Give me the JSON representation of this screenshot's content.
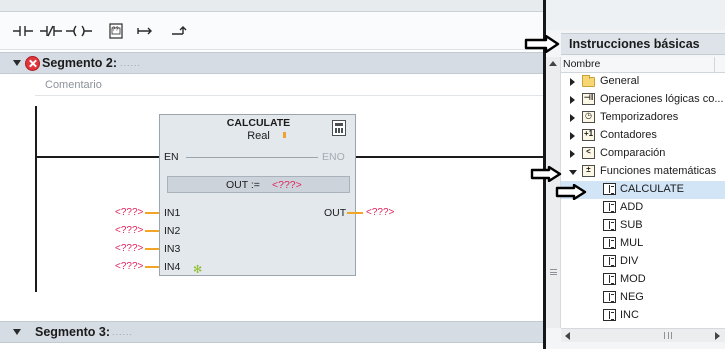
{
  "toolbar": {
    "items": [
      "no-contact-icon",
      "nc-contact-icon",
      "coil-icon",
      "empty-box-icon",
      "open-branch-icon",
      "close-branch-icon"
    ],
    "empty_box_label": "??"
  },
  "segments": [
    {
      "title": "Segmento 2:",
      "dots": "......",
      "has_error": true,
      "comment_placeholder": "Comentario"
    },
    {
      "title": "Segmento 3:",
      "dots": "......",
      "has_error": false
    }
  ],
  "block": {
    "name": "CALCULATE",
    "data_type": "Real",
    "en": "EN",
    "eno": "ENO",
    "expression": "OUT :=",
    "expression_value": "<???>",
    "output": "OUT",
    "output_value": "<???>",
    "inputs": [
      {
        "pin": "IN1",
        "value": "<???>"
      },
      {
        "pin": "IN2",
        "value": "<???>"
      },
      {
        "pin": "IN3",
        "value": "<???>"
      },
      {
        "pin": "IN4",
        "value": "<???>"
      }
    ]
  },
  "panel": {
    "title": "Instrucciones básicas",
    "column_header": "Nombre",
    "tree": [
      {
        "label": "General",
        "icon": "folder-icon",
        "level": 0,
        "expanded": false
      },
      {
        "label": "Operaciones lógicas co...",
        "icon": "bit-logic-icon",
        "icon_text": "⊣I",
        "level": 0,
        "expanded": false
      },
      {
        "label": "Temporizadores",
        "icon": "timer-icon",
        "icon_text": "◷",
        "level": 0,
        "expanded": false
      },
      {
        "label": "Contadores",
        "icon": "counter-icon",
        "icon_text": "+1",
        "level": 0,
        "expanded": false
      },
      {
        "label": "Comparación",
        "icon": "comparator-icon",
        "icon_text": "<",
        "level": 0,
        "expanded": false
      },
      {
        "label": "Funciones matemáticas",
        "icon": "math-functions-icon",
        "icon_text": "±",
        "level": 0,
        "expanded": true
      },
      {
        "label": "CALCULATE",
        "icon": "instruction-icon",
        "level": 1,
        "selected": true
      },
      {
        "label": "ADD",
        "icon": "instruction-icon",
        "level": 1
      },
      {
        "label": "SUB",
        "icon": "instruction-icon",
        "level": 1
      },
      {
        "label": "MUL",
        "icon": "instruction-icon",
        "level": 1
      },
      {
        "label": "DIV",
        "icon": "instruction-icon",
        "level": 1
      },
      {
        "label": "MOD",
        "icon": "instruction-icon",
        "level": 1
      },
      {
        "label": "NEG",
        "icon": "instruction-icon",
        "level": 1
      },
      {
        "label": "INC",
        "icon": "instruction-icon",
        "level": 1
      }
    ]
  },
  "colors": {
    "placeholder": "#e0245e",
    "wire": "#f1a626",
    "selection": "#d2e5f7",
    "error": "#e2343b"
  }
}
